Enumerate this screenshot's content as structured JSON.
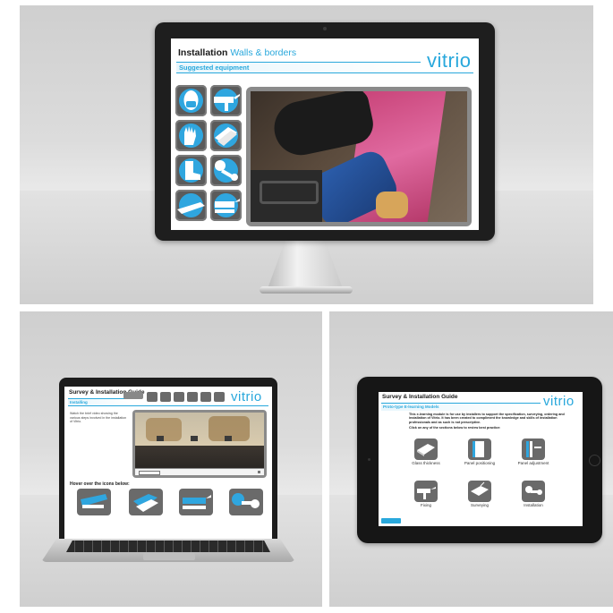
{
  "monitor": {
    "header_title": "Installation",
    "header_accent": "Walls & borders",
    "subheader": "Suggested equipment",
    "logo": "vitrio",
    "equipment_icons": [
      "face-mask-icon",
      "sealant-gun-icon",
      "gloves-icon",
      "glass-panels-icon",
      "boots-icon",
      "suction-lifter-icon",
      "glass-pane-icon",
      "sealant-applicator-icon"
    ],
    "video_label": "installation-video"
  },
  "laptop": {
    "header_title": "Survey & Installation Guide",
    "subheader": "Installing",
    "logo": "vitrio",
    "intro_text": "Watch the brief video showing the various steps involved in the installation of Vitrio.",
    "hover_prompt": "Hover over the icons below:",
    "bottom_icons": [
      "sealant-gun-icon",
      "glass-panels-icon",
      "sealant-applicator-icon",
      "suction-lifter-icon"
    ]
  },
  "tablet": {
    "header_title": "Survey & Installation Guide",
    "subheader": "Proto-type E-learning Models",
    "logo": "vitrio",
    "intro_text": "This e-learning module is for use by installers to support the specification, surveying, ordering and installation of Vitrio. It has been created to compliment the knowledge and skills of installation professionals and as such is not prescriptive.",
    "prompt": "Click on any of the sections below to review best practice:",
    "sections": [
      {
        "label": "Glass thickness",
        "icon": "glass-thickness-icon"
      },
      {
        "label": "Panel positioning",
        "icon": "panel-positioning-icon"
      },
      {
        "label": "Panel adjustment",
        "icon": "panel-adjustment-icon"
      },
      {
        "label": "Fixing",
        "icon": "sealant-gun-icon"
      },
      {
        "label": "Surveying",
        "icon": "surveying-icon"
      },
      {
        "label": "Installation",
        "icon": "suction-lifter-icon"
      }
    ]
  },
  "colors": {
    "accent": "#29a8dc",
    "tile_bg": "#5b5b5b",
    "device_bezel": "#1e1e1e"
  }
}
